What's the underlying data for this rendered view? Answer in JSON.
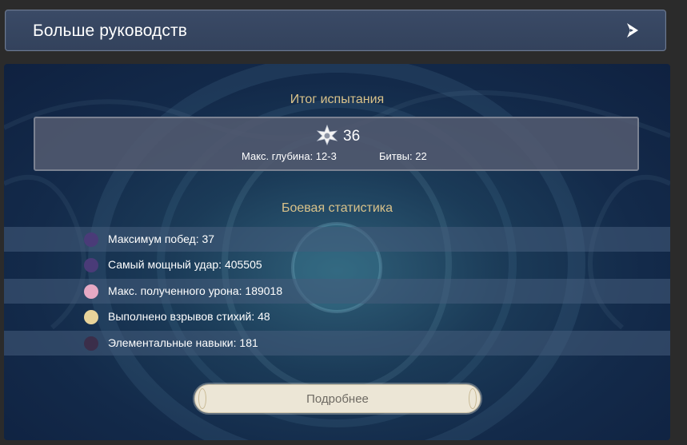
{
  "header": {
    "title": "Больше руководств",
    "arrow_icon": "arrow-right-icon"
  },
  "summary": {
    "title": "Итог испытания",
    "star_icon": "abyss-star-icon",
    "stars": "36",
    "max_depth": "Макс. глубина: 12-3",
    "battles": "Битвы: 22"
  },
  "battle_stats": {
    "title": "Боевая статистика",
    "rows": [
      {
        "text": "Максимум побед: 37",
        "avatar_color": "#4a3b78"
      },
      {
        "text": "Самый мощный удар: 405505",
        "avatar_color": "#4a3b78"
      },
      {
        "text": "Макс. полученного урона: 189018",
        "avatar_color": "#e6a9c4"
      },
      {
        "text": "Выполнено взрывов стихий: 48",
        "avatar_color": "#e8d39a"
      },
      {
        "text": "Элементальные навыки: 181",
        "avatar_color": "#3b2e4a"
      }
    ]
  },
  "details_button": {
    "label": "Подробнее"
  }
}
